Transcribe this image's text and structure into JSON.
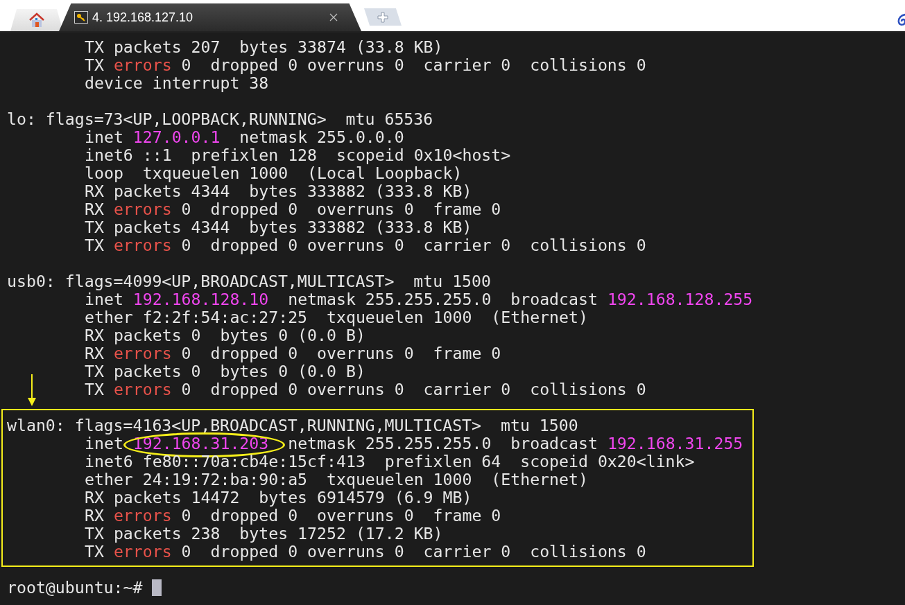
{
  "tabs": [
    {
      "kind": "home",
      "selected": false
    },
    {
      "kind": "session",
      "title": "4. 192.168.127.10",
      "selected": true
    }
  ],
  "terminal": {
    "blocks": [
      {
        "highlighted": false,
        "details": [
          [
            {
              "text": "TX packets 207  bytes 33874 (33.8 KB)",
              "kind": "plain"
            }
          ],
          [
            {
              "text": "TX ",
              "kind": "plain"
            },
            {
              "text": "errors",
              "kind": "error"
            },
            {
              "text": " 0  dropped 0 overruns 0  carrier 0  collisions 0",
              "kind": "plain"
            }
          ],
          [
            {
              "text": "device interrupt 38",
              "kind": "plain"
            }
          ]
        ]
      },
      {
        "highlighted": false,
        "header": "lo: flags=73<UP,LOOPBACK,RUNNING>  mtu 65536",
        "details": [
          [
            {
              "text": "inet ",
              "kind": "plain"
            },
            {
              "text": "127.0.0.1",
              "kind": "address"
            },
            {
              "text": "  netmask 255.0.0.0",
              "kind": "plain"
            }
          ],
          [
            {
              "text": "inet6 ::1  prefixlen 128  scopeid 0x10<host>",
              "kind": "plain"
            }
          ],
          [
            {
              "text": "loop  txqueuelen 1000  (Local Loopback)",
              "kind": "plain"
            }
          ],
          [
            {
              "text": "RX packets 4344  bytes 333882 (333.8 KB)",
              "kind": "plain"
            }
          ],
          [
            {
              "text": "RX ",
              "kind": "plain"
            },
            {
              "text": "errors",
              "kind": "error"
            },
            {
              "text": " 0  dropped 0  overruns 0  frame 0",
              "kind": "plain"
            }
          ],
          [
            {
              "text": "TX packets 4344  bytes 333882 (333.8 KB)",
              "kind": "plain"
            }
          ],
          [
            {
              "text": "TX ",
              "kind": "plain"
            },
            {
              "text": "errors",
              "kind": "error"
            },
            {
              "text": " 0  dropped 0 overruns 0  carrier 0  collisions 0",
              "kind": "plain"
            }
          ]
        ]
      },
      {
        "highlighted": false,
        "header": "usb0: flags=4099<UP,BROADCAST,MULTICAST>  mtu 1500",
        "details": [
          [
            {
              "text": "inet ",
              "kind": "plain"
            },
            {
              "text": "192.168.128.10",
              "kind": "address"
            },
            {
              "text": "  netmask 255.255.255.0  broadcast ",
              "kind": "plain"
            },
            {
              "text": "192.168.128.255",
              "kind": "address"
            }
          ],
          [
            {
              "text": "ether f2:2f:54:ac:27:25  txqueuelen 1000  (Ethernet)",
              "kind": "plain"
            }
          ],
          [
            {
              "text": "RX packets 0  bytes 0 (0.0 B)",
              "kind": "plain"
            }
          ],
          [
            {
              "text": "RX ",
              "kind": "plain"
            },
            {
              "text": "errors",
              "kind": "error"
            },
            {
              "text": " 0  dropped 0  overruns 0  frame 0",
              "kind": "plain"
            }
          ],
          [
            {
              "text": "TX packets 0  bytes 0 (0.0 B)",
              "kind": "plain"
            }
          ],
          [
            {
              "text": "TX ",
              "kind": "plain"
            },
            {
              "text": "errors",
              "kind": "error"
            },
            {
              "text": " 0  dropped 0 overruns 0  carrier 0  collisions 0",
              "kind": "plain"
            }
          ]
        ]
      },
      {
        "highlighted": true,
        "header": "wlan0: flags=4163<UP,BROADCAST,RUNNING,MULTICAST>  mtu 1500",
        "details": [
          [
            {
              "text": "inet ",
              "kind": "plain"
            },
            {
              "text": "192.168.31.203",
              "kind": "address",
              "circled": true
            },
            {
              "text": "  netmask 255.255.255.0  broadcast ",
              "kind": "plain"
            },
            {
              "text": "192.168.31.255",
              "kind": "address"
            }
          ],
          [
            {
              "text": "inet6 fe80::70a:cb4e:15cf:413  prefixlen 64  scopeid 0x20<link>",
              "kind": "plain"
            }
          ],
          [
            {
              "text": "ether 24:19:72:ba:90:a5  txqueuelen 1000  (Ethernet)",
              "kind": "plain"
            }
          ],
          [
            {
              "text": "RX packets 14472  bytes 6914579 (6.9 MB)",
              "kind": "plain"
            }
          ],
          [
            {
              "text": "RX ",
              "kind": "plain"
            },
            {
              "text": "errors",
              "kind": "error"
            },
            {
              "text": " 0  dropped 0  overruns 0  frame 0",
              "kind": "plain"
            }
          ],
          [
            {
              "text": "TX packets 238  bytes 17252 (17.2 KB)",
              "kind": "plain"
            }
          ],
          [
            {
              "text": "TX ",
              "kind": "plain"
            },
            {
              "text": "errors",
              "kind": "error"
            },
            {
              "text": " 0  dropped 0 overruns 0  carrier 0  collisions 0",
              "kind": "plain"
            }
          ]
        ]
      }
    ],
    "prompt": "root@ubuntu:~#"
  }
}
